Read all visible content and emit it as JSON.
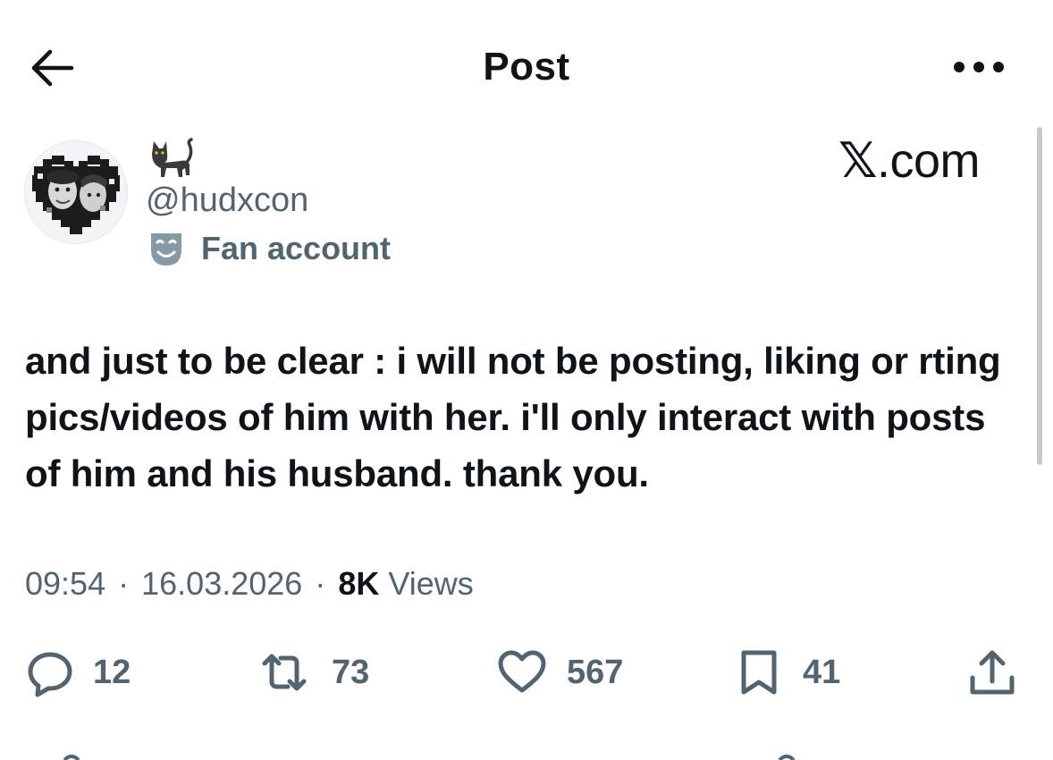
{
  "header": {
    "title": "Post",
    "back_icon": "arrow-left-icon",
    "more_icon": "more-horizontal-icon"
  },
  "author": {
    "display_name_icon": "cat-emoji-icon",
    "handle": "@hudxcon",
    "label_icon": "theater-mask-icon",
    "label": "Fan account"
  },
  "watermark": {
    "x": "𝕏",
    "suffix": ".com"
  },
  "post": {
    "text": "and just to be clear : i will not be posting, liking or rting pics/videos of him with her. i'll only interact with posts of him and his husband. thank you."
  },
  "meta": {
    "time": "09:54",
    "date": "16.03.2026",
    "views_count": "8K",
    "views_label": "Views",
    "separator": "·"
  },
  "actions": {
    "replies": "12",
    "reposts": "73",
    "likes": "567",
    "bookmarks": "41"
  },
  "colors": {
    "text": "#0f1419",
    "secondary": "#536471",
    "background": "#ffffff"
  }
}
